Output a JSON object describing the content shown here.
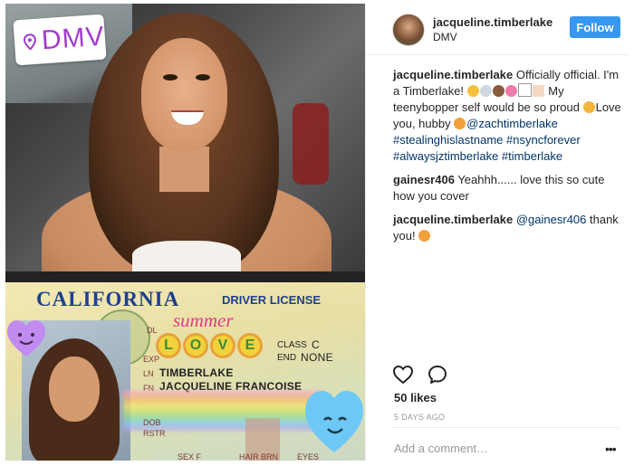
{
  "post": {
    "location_sticker": "DMV",
    "license": {
      "state": "CALIFORNIA",
      "title": "DRIVER LICENSE",
      "sticker_summer": "summer",
      "sticker_love": [
        "L",
        "O",
        "V",
        "E"
      ],
      "dl_label": "DL",
      "exp_label": "EXP",
      "ln_label": "LN",
      "ln_value": "TIMBERLAKE",
      "fn_label": "FN",
      "fn_value": "JACQUELINE FRANCOISE",
      "class_label": "CLASS",
      "class_value": "C",
      "end_label": "END",
      "end_value": "NONE",
      "dob_label": "DOB",
      "rstr_label": "RSTR",
      "sex_label": "SEX F",
      "hair_label": "HAIR BRN",
      "eyes_label": "EYES"
    }
  },
  "header": {
    "username": "jacqueline.timberlake",
    "location": "DMV",
    "follow_label": "Follow"
  },
  "comments": [
    {
      "user": "jacqueline.timberlake",
      "text_1": " Officially official. I'm a Timberlake! ",
      "text_2": " My teenybopper self would be so proud ",
      "text_3": "Love you, hubby ",
      "mention": "@zachtimberlake",
      "hashtags": "#stealinghislastname #nsyncforever #alwaysjztimberlake #timberlake"
    },
    {
      "user": "gainesr406",
      "text": " Yeahhh...... love this so cute how you cover"
    },
    {
      "user": "jacqueline.timberlake",
      "mention": "@gainesr406",
      "text": " thank you! "
    }
  ],
  "footer": {
    "likes": "50 likes",
    "timestamp": "5 DAYS AGO",
    "add_comment_placeholder": "Add a comment…",
    "more_label": "•••"
  },
  "icons": [
    "heart-icon",
    "comment-icon",
    "location-pin-icon",
    "more-icon"
  ],
  "colors": {
    "follow": "#3897f0",
    "link": "#003569",
    "sticker_text": "#a13cc9",
    "license_blue": "#1d3f8f"
  }
}
